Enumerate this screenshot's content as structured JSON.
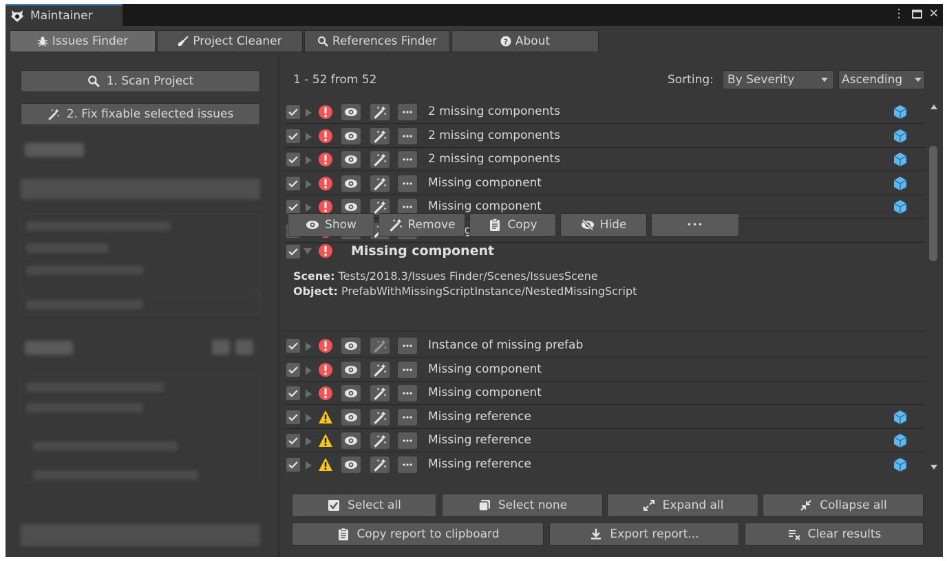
{
  "window": {
    "title": "Maintainer",
    "controls": [
      "more-icon",
      "maximize-icon",
      "close-icon"
    ]
  },
  "tabs": [
    {
      "label": "Issues Finder",
      "icon": "bug-icon",
      "active": true
    },
    {
      "label": "Project Cleaner",
      "icon": "broom-icon",
      "active": false
    },
    {
      "label": "References Finder",
      "icon": "search-icon",
      "active": false
    },
    {
      "label": "About",
      "icon": "question-icon",
      "active": false
    }
  ],
  "left": {
    "scan_label": "1. Scan Project",
    "fix_label": "2. Fix fixable selected issues"
  },
  "results": {
    "status": "1 - 52 from 52",
    "sorting_label": "Sorting:",
    "sort_by": "By Severity",
    "sort_order": "Ascending"
  },
  "issues": [
    {
      "label": "2 missing components",
      "severity": "error",
      "cube": true,
      "fixable": true
    },
    {
      "label": "2 missing components",
      "severity": "error",
      "cube": true,
      "fixable": true
    },
    {
      "label": "2 missing components",
      "severity": "error",
      "cube": true,
      "fixable": true
    },
    {
      "label": "Missing component",
      "severity": "error",
      "cube": true,
      "fixable": true
    },
    {
      "label": "Missing component",
      "severity": "error",
      "cube": true,
      "fixable": true
    },
    {
      "label": "Missing component",
      "severity": "error",
      "cube": false,
      "fixable": true
    }
  ],
  "expanded": {
    "title": "Missing component",
    "scene_label": "Scene:",
    "scene_value": "Tests/2018.3/Issues Finder/Scenes/IssuesScene",
    "object_label": "Object:",
    "object_value": "PrefabWithMissingScriptInstance/NestedMissingScript",
    "buttons": {
      "show": "Show",
      "remove": "Remove",
      "copy": "Copy",
      "hide": "Hide",
      "more": "•••"
    }
  },
  "issues_after": [
    {
      "label": "Instance of missing prefab",
      "severity": "error",
      "cube": false,
      "fixable": false
    },
    {
      "label": "Missing component",
      "severity": "error",
      "cube": false,
      "fixable": true
    },
    {
      "label": "Missing component",
      "severity": "error",
      "cube": false,
      "fixable": true
    },
    {
      "label": "Missing reference",
      "severity": "warning",
      "cube": true,
      "fixable": true
    },
    {
      "label": "Missing reference",
      "severity": "warning",
      "cube": true,
      "fixable": true
    },
    {
      "label": "Missing reference",
      "severity": "warning",
      "cube": true,
      "fixable": true
    }
  ],
  "bottom": {
    "select_all": "Select all",
    "select_none": "Select none",
    "expand_all": "Expand all",
    "collapse_all": "Collapse all",
    "copy_report": "Copy report to clipboard",
    "export_report": "Export report...",
    "clear_results": "Clear results"
  },
  "colors": {
    "error": "#f05454",
    "warning": "#f5c518",
    "cube": "#5db7f0",
    "accent": "#3a79bb"
  }
}
